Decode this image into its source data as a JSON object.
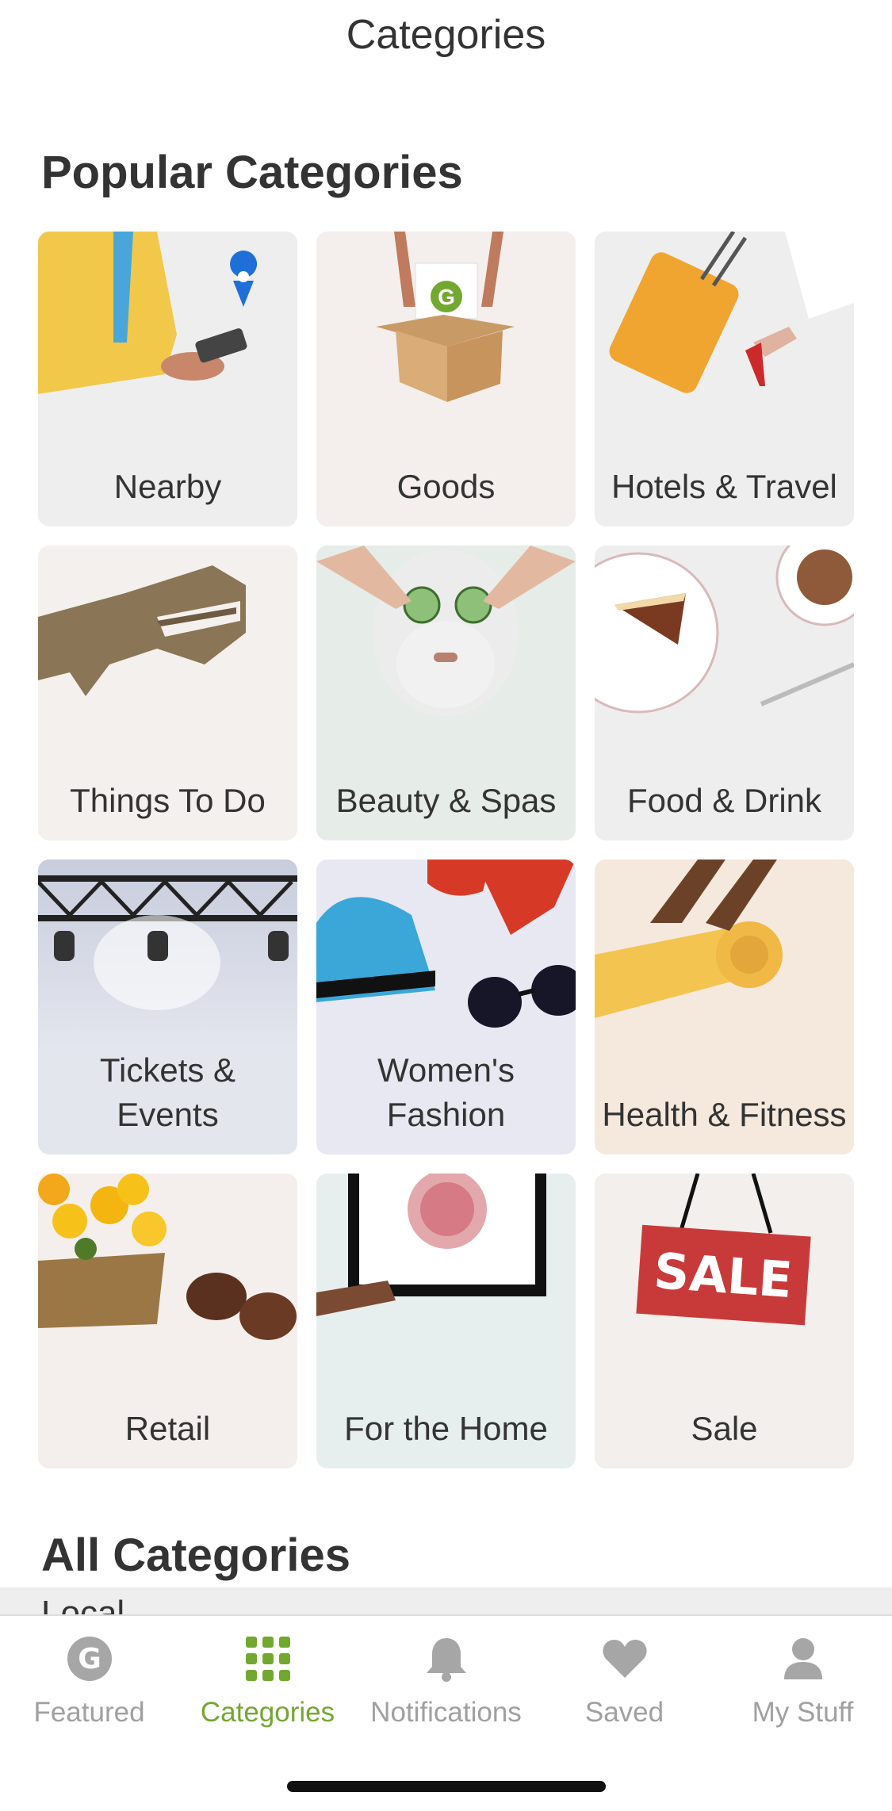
{
  "header": {
    "title": "Categories"
  },
  "popular": {
    "title": "Popular Categories",
    "tiles": [
      {
        "label": "Nearby",
        "bg": "#eeeeee"
      },
      {
        "label": "Goods",
        "bg": "#f4efec"
      },
      {
        "label": "Hotels & Travel",
        "bg": "#eeeeee"
      },
      {
        "label": "Things To Do",
        "bg": "#f4f0ed"
      },
      {
        "label": "Beauty & Spas",
        "bg": "#e6ece8"
      },
      {
        "label": "Food & Drink",
        "bg": "#eeeeee"
      },
      {
        "label": "Tickets & Events",
        "bg": "#e4e6ee"
      },
      {
        "label": "Women's Fashion",
        "bg": "#e8e8f2"
      },
      {
        "label": "Health & Fitness",
        "bg": "#f5e8dc"
      },
      {
        "label": "Retail",
        "bg": "#f4efec"
      },
      {
        "label": "For the Home",
        "bg": "#e6efee"
      },
      {
        "label": "Sale",
        "bg": "#f2efec"
      }
    ]
  },
  "all": {
    "title": "All Categories",
    "first_item": "Local"
  },
  "tabbar": {
    "active_color": "#72a82f",
    "inactive_color": "#a0a0a0",
    "tabs": [
      {
        "label": "Featured",
        "icon": "groupon-g-icon"
      },
      {
        "label": "Categories",
        "icon": "grid-icon"
      },
      {
        "label": "Notifications",
        "icon": "bell-icon"
      },
      {
        "label": "Saved",
        "icon": "heart-icon"
      },
      {
        "label": "My Stuff",
        "icon": "person-icon"
      }
    ]
  }
}
